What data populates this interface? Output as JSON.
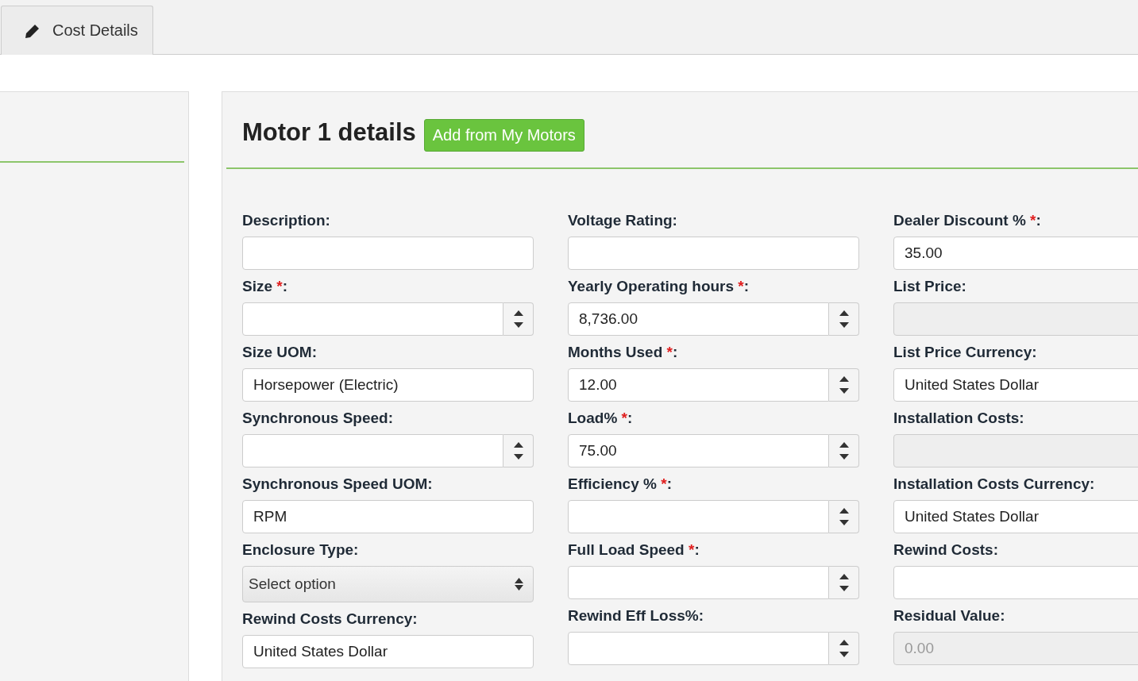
{
  "tabs": [
    {
      "label": "Cost Details",
      "selected": true
    }
  ],
  "panel": {
    "title": "Motor 1 details",
    "add_button": "Add from My Motors"
  },
  "columns": [
    [
      {
        "label": "Description",
        "colon": ":",
        "kind": "text"
      },
      {
        "label": "Size",
        "asterisk": "*",
        "colon": ":",
        "kind": "number"
      },
      {
        "label": "Size UOM",
        "colon": ":",
        "kind": "text",
        "value": "Horsepower (Electric)"
      },
      {
        "label": "Synchronous Speed",
        "colon": ":",
        "kind": "number"
      },
      {
        "label": "Synchronous Speed UOM",
        "colon": ":",
        "kind": "text",
        "value": "RPM"
      },
      {
        "label": "Enclosure Type",
        "colon": ":",
        "kind": "select",
        "placeholder": "Select option"
      },
      {
        "label": "Rewind Costs Currency",
        "colon": ":",
        "kind": "text",
        "value": "United States Dollar"
      }
    ],
    [
      {
        "label": "Voltage Rating",
        "colon": ":",
        "kind": "text"
      },
      {
        "label": "Yearly Operating hours",
        "asterisk": "*",
        "colon": ":",
        "kind": "number",
        "value": "8,736.00"
      },
      {
        "label": "Months Used",
        "asterisk": "*",
        "colon": ":",
        "kind": "number",
        "value": "12.00"
      },
      {
        "label": "Load%",
        "asterisk": "*",
        "colon": ":",
        "kind": "number",
        "value": "75.00"
      },
      {
        "label": "Efficiency %",
        "asterisk": "*",
        "colon": " :",
        "kind": "number"
      },
      {
        "label": "Full Load Speed",
        "asterisk": "*",
        "colon": " :",
        "kind": "number"
      },
      {
        "label": "Rewind Eff Loss%",
        "colon": ":",
        "kind": "number"
      }
    ],
    [
      {
        "label": "Dealer Discount %",
        "asterisk": "*",
        "colon": ":",
        "kind": "text",
        "value": "35.00"
      },
      {
        "label": "List Price",
        "colon": ":",
        "kind": "disabled"
      },
      {
        "label": "List Price Currency",
        "colon": ":",
        "kind": "text",
        "value": "United States Dollar"
      },
      {
        "label": "Installation Costs",
        "colon": ":",
        "kind": "disabled"
      },
      {
        "label": "Installation Costs Currency",
        "colon": ":",
        "kind": "text",
        "value": "United States Dollar"
      },
      {
        "label": "Rewind Costs",
        "colon": ":",
        "kind": "text"
      },
      {
        "label": "Residual Value",
        "colon": ":",
        "kind": "disabled",
        "placeholder": "0.00"
      }
    ]
  ]
}
